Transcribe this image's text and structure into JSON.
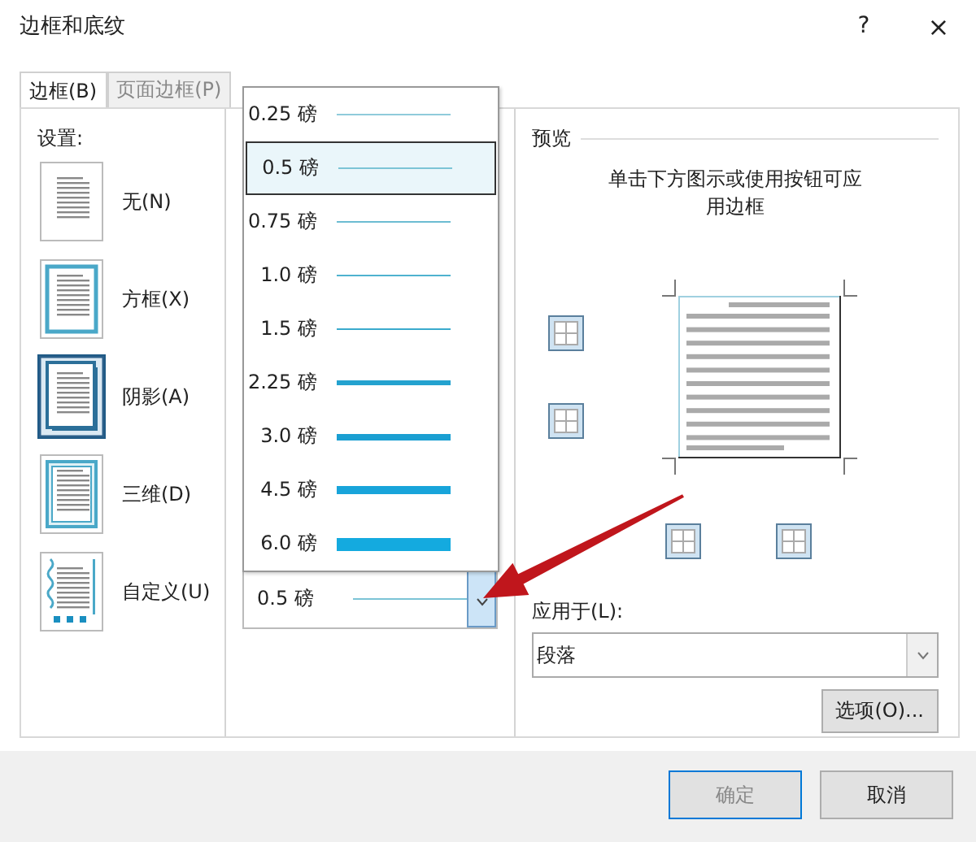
{
  "window": {
    "title": "边框和底纹",
    "help": "?",
    "close": "×"
  },
  "tabs": [
    {
      "label": "边框(B)",
      "selected": true
    },
    {
      "label": "页面边框(P)",
      "selected": false
    }
  ],
  "settings": {
    "label": "设置:",
    "items": [
      {
        "label": "无(N)",
        "kind": "none",
        "selected": false
      },
      {
        "label": "方框(X)",
        "kind": "box",
        "selected": false
      },
      {
        "label": "阴影(A)",
        "kind": "shadow",
        "selected": true
      },
      {
        "label": "三维(D)",
        "kind": "threed",
        "selected": false
      },
      {
        "label": "自定义(U)",
        "kind": "custom",
        "selected": false
      }
    ]
  },
  "width_list": {
    "items": [
      {
        "label": "0.25 磅",
        "kind": "hairline",
        "selected": false
      },
      {
        "label": "0.5 磅",
        "kind": "thin",
        "selected": true
      },
      {
        "label": "0.75 磅",
        "kind": "light",
        "selected": false
      },
      {
        "label": "1.0 磅",
        "kind": "regular",
        "selected": false
      },
      {
        "label": "1.5 磅",
        "kind": "medium",
        "selected": false
      },
      {
        "label": "2.25 磅",
        "kind": "semibold",
        "selected": false
      },
      {
        "label": "3.0 磅",
        "kind": "bold",
        "selected": false
      },
      {
        "label": "4.5 磅",
        "kind": "heavy",
        "selected": false
      },
      {
        "label": "6.0 磅",
        "kind": "black",
        "selected": false
      }
    ],
    "value": "0.5 磅"
  },
  "preview": {
    "label": "预览",
    "hint": "单击下方图示或使用按钮可应用边框"
  },
  "apply_to": {
    "label": "应用于(L):",
    "value": "段落"
  },
  "options_button": "选项(O)...",
  "buttons": [
    {
      "label": "确定"
    },
    {
      "label": "取消"
    }
  ]
}
